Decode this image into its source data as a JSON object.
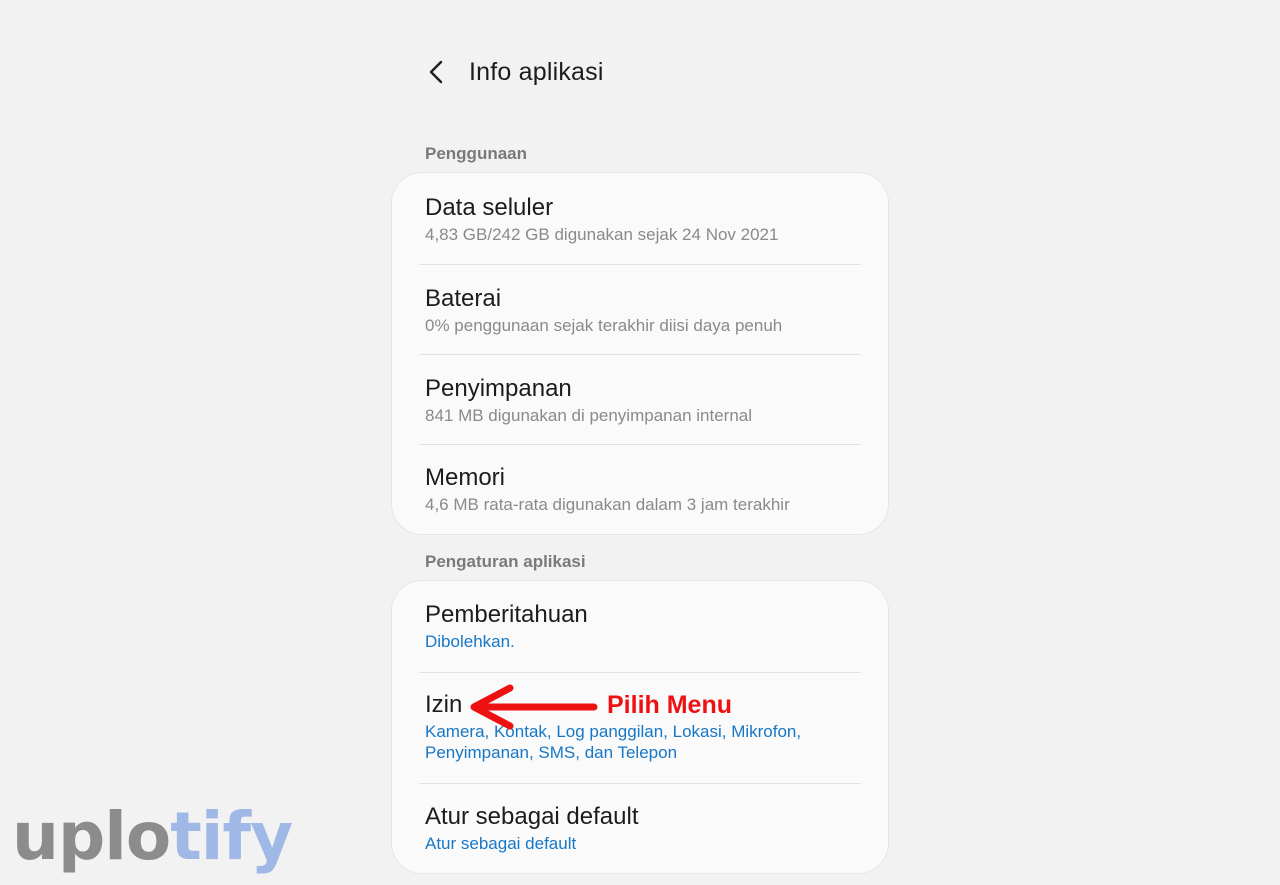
{
  "header": {
    "back_icon": "chevron-left-icon",
    "title": "Info aplikasi"
  },
  "sections": [
    {
      "label": "Penggunaan",
      "items": [
        {
          "title": "Data seluler",
          "subtitle": "4,83 GB/242 GB digunakan sejak 24 Nov 2021"
        },
        {
          "title": "Baterai",
          "subtitle": "0% penggunaan sejak terakhir diisi daya penuh"
        },
        {
          "title": "Penyimpanan",
          "subtitle": "841 MB digunakan di penyimpanan internal"
        },
        {
          "title": "Memori",
          "subtitle": "4,6 MB rata-rata digunakan dalam 3 jam terakhir"
        }
      ]
    },
    {
      "label": "Pengaturan aplikasi",
      "items": [
        {
          "title": "Pemberitahuan",
          "subtitle": "Dibolehkan."
        },
        {
          "title": "Izin",
          "subtitle": "Kamera, Kontak, Log panggilan, Lokasi, Mikrofon, Penyimpanan, SMS, dan Telepon"
        },
        {
          "title": "Atur sebagai default",
          "subtitle": "Atur sebagai default"
        }
      ]
    }
  ],
  "annotation": {
    "text": "Pilih Menu",
    "color": "#ee1111",
    "icon": "arrow-left-icon"
  },
  "watermark": {
    "part1": "uplo",
    "part2": "tify"
  },
  "colors": {
    "accent_link": "#1677c7",
    "background": "#f2f2f2",
    "card": "#fafafa"
  }
}
